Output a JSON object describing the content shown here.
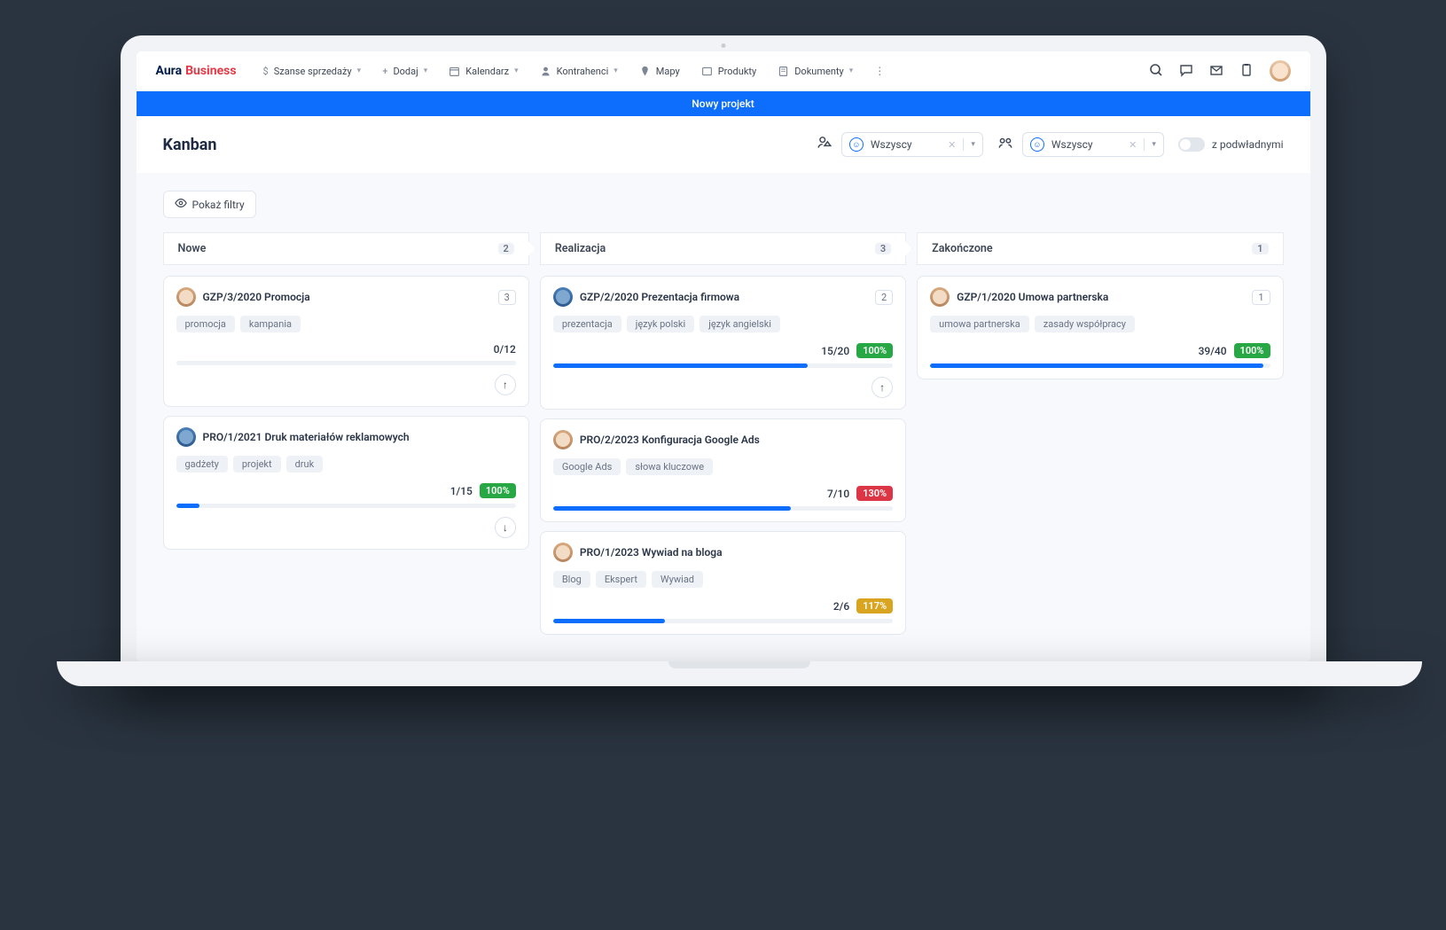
{
  "brand": {
    "a": "Aura",
    "b": "Business"
  },
  "nav": {
    "szanse": "Szanse sprzedaży",
    "dodaj": "Dodaj",
    "kalendarz": "Kalendarz",
    "kontrahenci": "Kontrahenci",
    "mapy": "Mapy",
    "produkty": "Produkty",
    "dokumenty": "Dokumenty"
  },
  "blue_bar": "Nowy projekt",
  "page_title": "Kanban",
  "selector1": "Wszyscy",
  "selector2": "Wszyscy",
  "toggle_label": "z podwładnymi",
  "show_filters": "Pokaż filtry",
  "columns": {
    "nowe": {
      "label": "Nowe",
      "count": "2"
    },
    "realizacja": {
      "label": "Realizacja",
      "count": "3"
    },
    "zakonczone": {
      "label": "Zakończone",
      "count": "1"
    }
  },
  "cards": {
    "c1": {
      "title": "GZP/3/2020 Promocja",
      "count": "3",
      "tags": [
        "promocja",
        "kampania"
      ],
      "progress_text": "0/12",
      "badge": "",
      "fill_pct": 0
    },
    "c2": {
      "title": "PRO/1/2021 Druk materiałów reklamowych",
      "count": "",
      "tags": [
        "gadżety",
        "projekt",
        "druk"
      ],
      "progress_text": "1/15",
      "badge": "100%",
      "badge_class": "badge-green",
      "fill_pct": 7
    },
    "c3": {
      "title": "GZP/2/2020 Prezentacja firmowa",
      "count": "2",
      "tags": [
        "prezentacja",
        "język polski",
        "język angielski"
      ],
      "progress_text": "15/20",
      "badge": "100%",
      "badge_class": "badge-green",
      "fill_pct": 75
    },
    "c4": {
      "title": "PRO/2/2023 Konfiguracja Google Ads",
      "count": "",
      "tags": [
        "Google Ads",
        "słowa kluczowe"
      ],
      "progress_text": "7/10",
      "badge": "130%",
      "badge_class": "badge-red",
      "fill_pct": 70
    },
    "c5": {
      "title": "PRO/1/2023 Wywiad na bloga",
      "count": "",
      "tags": [
        "Blog",
        "Ekspert",
        "Wywiad"
      ],
      "progress_text": "2/6",
      "badge": "117%",
      "badge_class": "badge-amber",
      "fill_pct": 33
    },
    "c6": {
      "title": "GZP/1/2020 Umowa partnerska",
      "count": "1",
      "tags": [
        "umowa partnerska",
        "zasady współpracy"
      ],
      "progress_text": "39/40",
      "badge": "100%",
      "badge_class": "badge-green",
      "fill_pct": 98
    }
  }
}
